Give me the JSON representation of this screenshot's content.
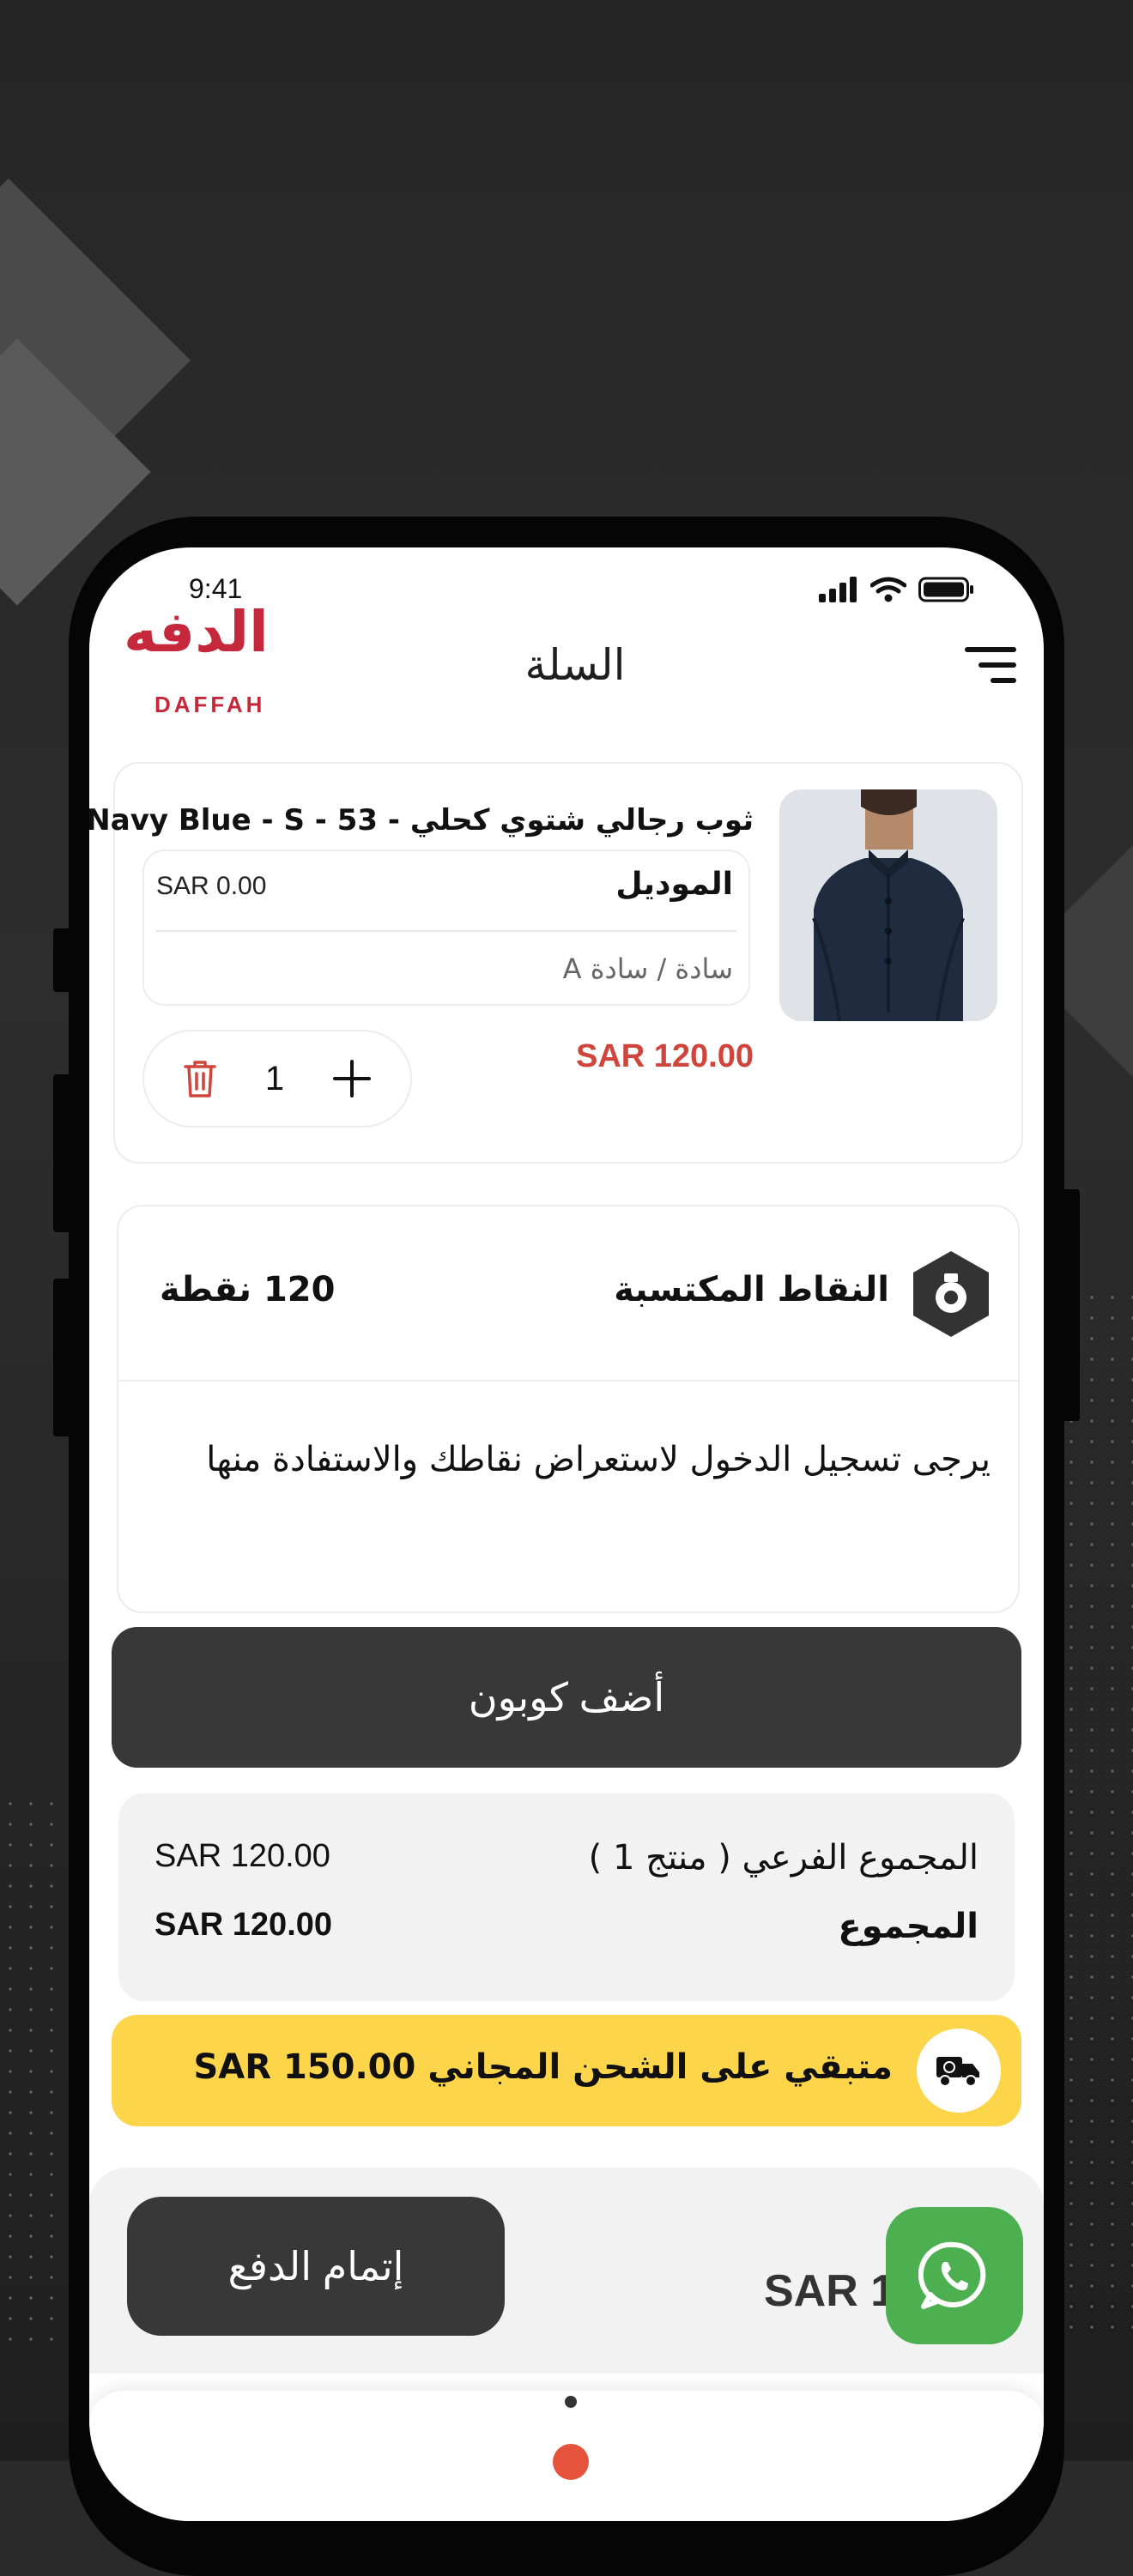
{
  "status_bar": {
    "time": "9:41"
  },
  "header": {
    "logo_arabic": "الدفه",
    "logo_latin": "DAFFAH",
    "title": "السلة",
    "menu_icon": "menu-lines-icon"
  },
  "cart_item": {
    "name": "ثوب رجالي شتوي كحلي - 53 - Navy Blue - S",
    "variant_label": "الموديل",
    "variant_price": "SAR 0.00",
    "variant_value": "سادة / سادة A",
    "price": "SAR 120.00",
    "quantity": "1",
    "price_color": "#d0453b"
  },
  "points": {
    "title": "النقاط المكتسبة",
    "value": "120 نقطة",
    "note": "يرجى تسجيل الدخول لاستعراض نقاطك والاستفادة منها"
  },
  "coupon": {
    "label": "أضف كوبون"
  },
  "totals": {
    "subtotal_label": "المجموع الفرعي ( منتج 1 )",
    "subtotal_value": "SAR 120.00",
    "total_label": "المجموع",
    "total_value": "SAR 120.00"
  },
  "shipping": {
    "text": "متبقي على الشحن المجاني SAR 150.00",
    "color": "#fdd54a"
  },
  "checkout": {
    "label": "إتمام الدفع",
    "total_visible": "SAR 1"
  },
  "colors": {
    "brand": "#c4283a",
    "dark_button": "#383838",
    "whatsapp": "#4caf50"
  }
}
